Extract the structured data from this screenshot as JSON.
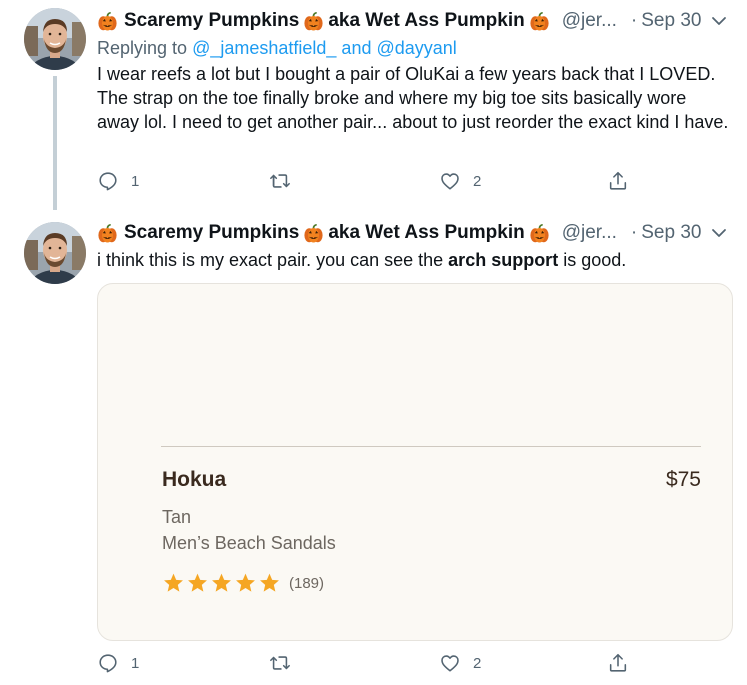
{
  "tweets": [
    {
      "author": {
        "name_part1": "Scaremy Pumpkins",
        "name_part2": "aka Wet Ass Pumpkin",
        "handle": "@jer...",
        "emoji_icon": "jack-o-lantern-icon"
      },
      "separator": "·",
      "time": "Sep 30",
      "reply_prefix": "Replying to",
      "reply_users": "@_jameshatfield_ and @dayyanl",
      "text": "I wear reefs a lot but I bought a pair of OluKai a few years back that I LOVED. The strap on the toe finally broke and where my big toe sits basically wore away lol. I need to get another pair... about to just reorder the exact kind I have.",
      "replies": "1",
      "retweets": "",
      "likes": "2"
    },
    {
      "author": {
        "name_part1": "Scaremy Pumpkins",
        "name_part2": "aka Wet Ass Pumpkin",
        "handle": "@jer...",
        "emoji_icon": "jack-o-lantern-icon"
      },
      "separator": "·",
      "time": "Sep 30",
      "text_before": "i think this is my exact pair. you can see the ",
      "text_bold": "arch support",
      "text_after": " is good.",
      "card": {
        "product_name": "Hokua",
        "price": "$75",
        "color": "Tan",
        "category": "Men’s Beach Sandals",
        "rating_stars": 5,
        "review_count": "(189)",
        "star_color": "#f5a623"
      },
      "replies": "1",
      "retweets": "",
      "likes": "2"
    }
  ],
  "colors": {
    "link": "#1d9bf0",
    "secondary_text": "#536471",
    "thread_line": "#c4cfd6",
    "card_background": "#fbf9f4"
  }
}
